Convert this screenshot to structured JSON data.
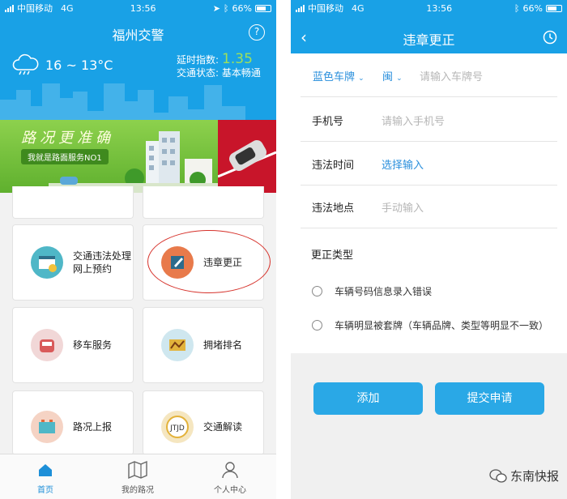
{
  "status": {
    "carrier": "中国移动",
    "network": "4G",
    "time": "13:56",
    "battery": "66%"
  },
  "left": {
    "title": "福州交警",
    "help": "?",
    "weather": {
      "temp": "16 ~ 13°C"
    },
    "delay": {
      "index_label": "延时指数:",
      "index_value": "1.35",
      "status_label": "交通状态:",
      "status_value": "基本畅通"
    },
    "banner": {
      "title": "路况更准确",
      "subtitle": "我就是路面服务NO1"
    },
    "tiles": [
      {
        "label": "交通违法处理网上预约",
        "color": "#4fb7c7"
      },
      {
        "label": "违章更正",
        "color": "#e87a4b"
      },
      {
        "label": "移车服务",
        "color": "#d95a5a"
      },
      {
        "label": "拥堵排名",
        "color": "#e2b33c"
      },
      {
        "label": "路况上报",
        "color": "#e36a3b"
      },
      {
        "label": "交通解读",
        "color": "#e3b23a"
      }
    ],
    "tabs": [
      {
        "label": "首页"
      },
      {
        "label": "我的路况"
      },
      {
        "label": "个人中心"
      }
    ]
  },
  "right": {
    "title": "违章更正",
    "plate": {
      "type": "蓝色车牌",
      "province": "闽",
      "placeholder": "请输入车牌号"
    },
    "phone": {
      "label": "手机号",
      "placeholder": "请输入手机号"
    },
    "time": {
      "label": "违法时间",
      "value": "选择输入"
    },
    "place": {
      "label": "违法地点",
      "placeholder": "手动输入"
    },
    "correction": {
      "title": "更正类型",
      "options": [
        "车辆号码信息录入错误",
        "车辆明显被套牌（车辆品牌、类型等明显不一致）"
      ]
    },
    "buttons": {
      "add": "添加",
      "submit": "提交申请"
    }
  },
  "watermark": "东南快报"
}
